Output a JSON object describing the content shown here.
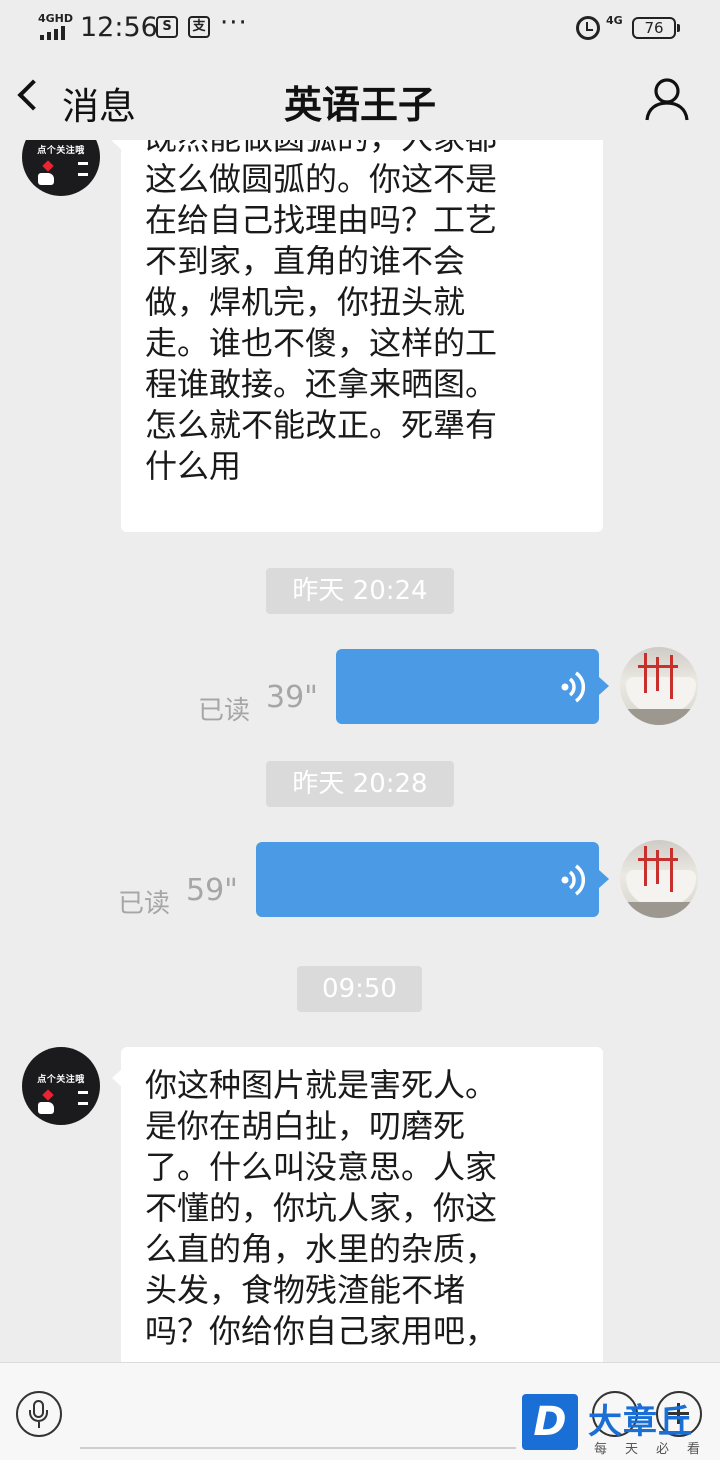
{
  "status_bar": {
    "network": "4GHD",
    "time": "12:56",
    "app_icon_1": "S",
    "app_icon_2": "支",
    "more": "···",
    "network_right": "4G",
    "battery": "76",
    "icons": [
      "signal-icon",
      "alarm-icon",
      "battery-icon"
    ]
  },
  "header": {
    "back_label": "消息",
    "title": "英语王子",
    "icons": [
      "back-chevron-icon",
      "profile-icon"
    ]
  },
  "avatar_left": {
    "text": "点个关注哦"
  },
  "messages": [
    {
      "type": "text",
      "side": "left",
      "lines": [
        "既然能做圆弧的，人家都",
        "这么做圆弧的。你这不是",
        "在给自己找理由吗？工艺",
        "不到家，直角的谁不会",
        "做，焊机完，你扭头就",
        "走。谁也不傻，这样的工",
        "程谁敢接。还拿来晒图。",
        "怎么就不能改正。死犟有",
        "什么用"
      ]
    },
    {
      "type": "time",
      "text": "昨天 20:24"
    },
    {
      "type": "voice",
      "side": "right",
      "status": "已读",
      "duration": "39\""
    },
    {
      "type": "time",
      "text": "昨天 20:28"
    },
    {
      "type": "voice",
      "side": "right",
      "status": "已读",
      "duration": "59\""
    },
    {
      "type": "time",
      "text": "09:50"
    },
    {
      "type": "text",
      "side": "left",
      "lines": [
        "你这种图片就是害死人。",
        "是你在胡白扯，叨磨死",
        "了。什么叫没意思。人家",
        "不懂的，你坑人家，你这",
        "么直的角，水里的杂质，",
        "头发，食物残渣能不堵",
        "吗？你给你自己家用吧，"
      ]
    }
  ],
  "input_bar": {
    "placeholder": "",
    "icons": [
      "microphone-icon",
      "emoji-icon",
      "plus-icon"
    ]
  },
  "watermark": {
    "logo_letter": "D",
    "name": "大章丘",
    "subtitle": "每天必看"
  },
  "colors": {
    "background": "#ededed",
    "voice_bubble": "#4a9ae6",
    "text_bubble": "#ffffff",
    "time_chip": "#dadada",
    "watermark": "#1a6fd6"
  }
}
